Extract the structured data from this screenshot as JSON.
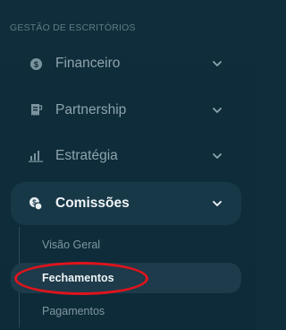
{
  "sidebar": {
    "section_title": "GESTÃO DE ESCRITÓRIOS",
    "items": [
      {
        "label": "Financeiro",
        "icon": "dollar-circle-icon",
        "expanded": false
      },
      {
        "label": "Partnership",
        "icon": "receipt-icon",
        "expanded": false
      },
      {
        "label": "Estratégia",
        "icon": "bar-chart-icon",
        "expanded": false
      },
      {
        "label": "Comissões",
        "icon": "coins-icon",
        "expanded": true
      }
    ],
    "subitems": [
      {
        "label": "Visão Geral",
        "active": false
      },
      {
        "label": "Fechamentos",
        "active": true
      },
      {
        "label": "Pagamentos",
        "active": false
      }
    ]
  },
  "colors": {
    "background": "#0f2d3b",
    "active_item_bg": "#173847",
    "annotation": "#e0141c"
  }
}
